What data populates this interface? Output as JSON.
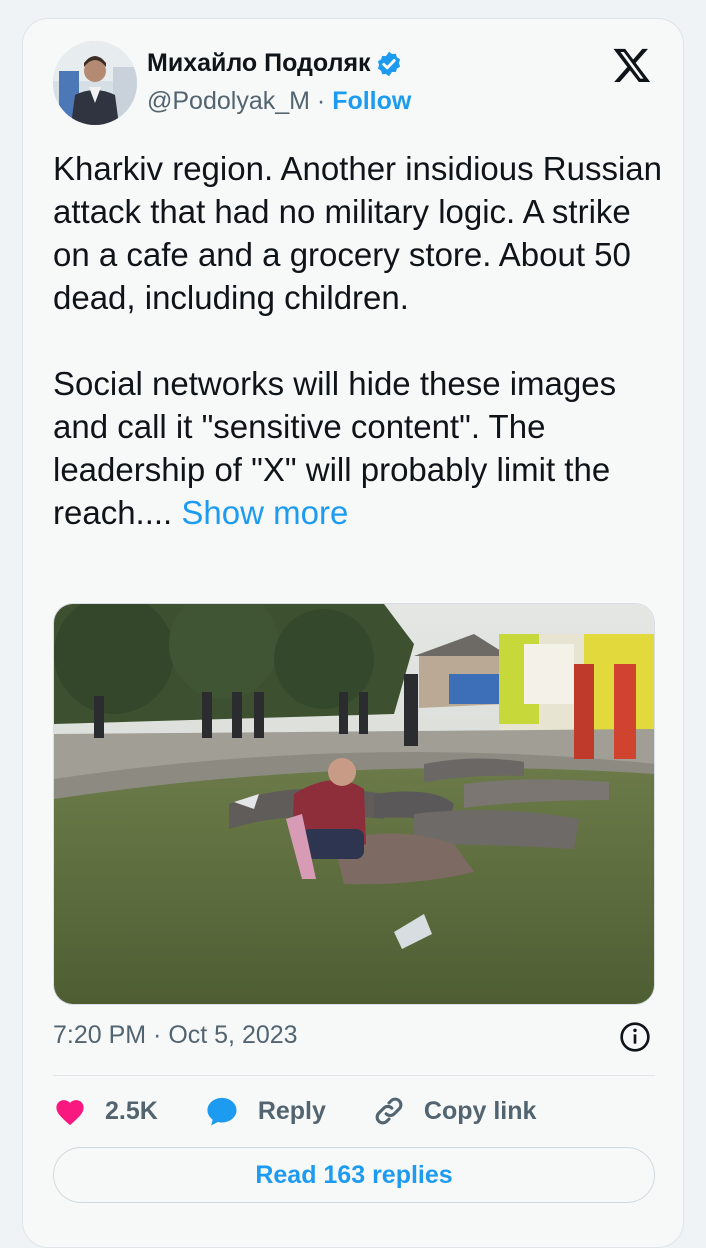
{
  "author": {
    "name": "Михайло Подоляк",
    "handle": "@Podolyak_M",
    "separator": "·",
    "follow_label": "Follow"
  },
  "platform": {
    "logo_icon": "x-logo-icon"
  },
  "tweet": {
    "paragraph1": "Kharkiv region. Another insidious Russian attack that had no military logic. A strike on a cafe and a grocery store. About 50 dead, including children.",
    "paragraph2": "Social networks will hide these images and call it \"sensitive content\". The leadership of \"X\" will probably limit the reach....",
    "show_more": "Show more",
    "timestamp": "7:20 PM · Oct 5, 2023"
  },
  "actions": {
    "like_count": "2.5K",
    "reply_label": "Reply",
    "copy_link_label": "Copy link"
  },
  "footer": {
    "read_replies_label": "Read 163 replies"
  },
  "colors": {
    "accent": "#1d9bf0",
    "like": "#f91880",
    "text_primary": "#0f1419",
    "text_secondary": "#536471"
  }
}
